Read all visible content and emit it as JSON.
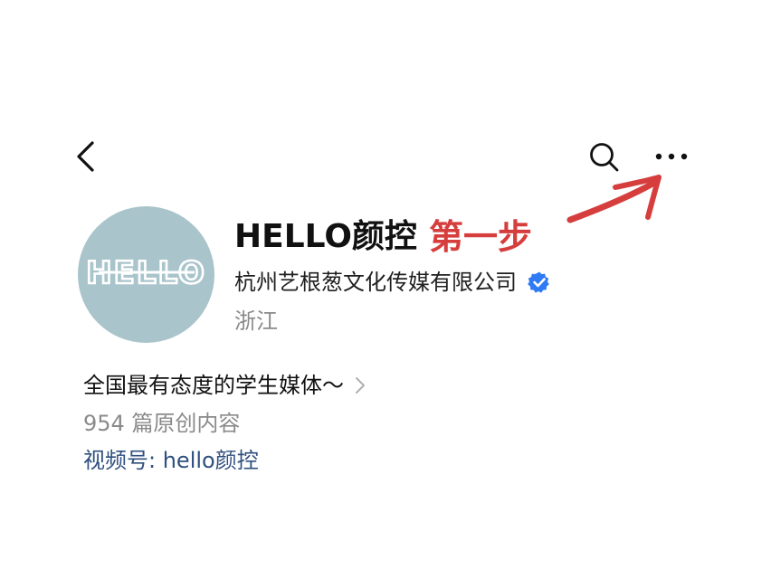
{
  "header": {
    "back_icon": "chevron-left-icon",
    "search_icon": "search-icon",
    "more_icon": "more-horizontal-icon"
  },
  "profile": {
    "avatar_logo_text": "HELLO",
    "name": "HELLO颜控",
    "company": "杭州艺根葱文化传媒有限公司",
    "verified_icon": "verified-check-icon",
    "region": "浙江",
    "bio": "全国最有态度的学生媒体～",
    "content_count": "954 篇原创内容",
    "video_account": "视频号: hello颜控"
  },
  "annotation": {
    "step_label": "第一步",
    "color": "#d63d3d",
    "arrow_icon": "red-arrow-annotation"
  },
  "colors": {
    "avatar_bg": "#a9c4cb",
    "verified": "#2f7bf5",
    "link": "#2f4f7f",
    "secondary_text": "#8a8a8a"
  }
}
